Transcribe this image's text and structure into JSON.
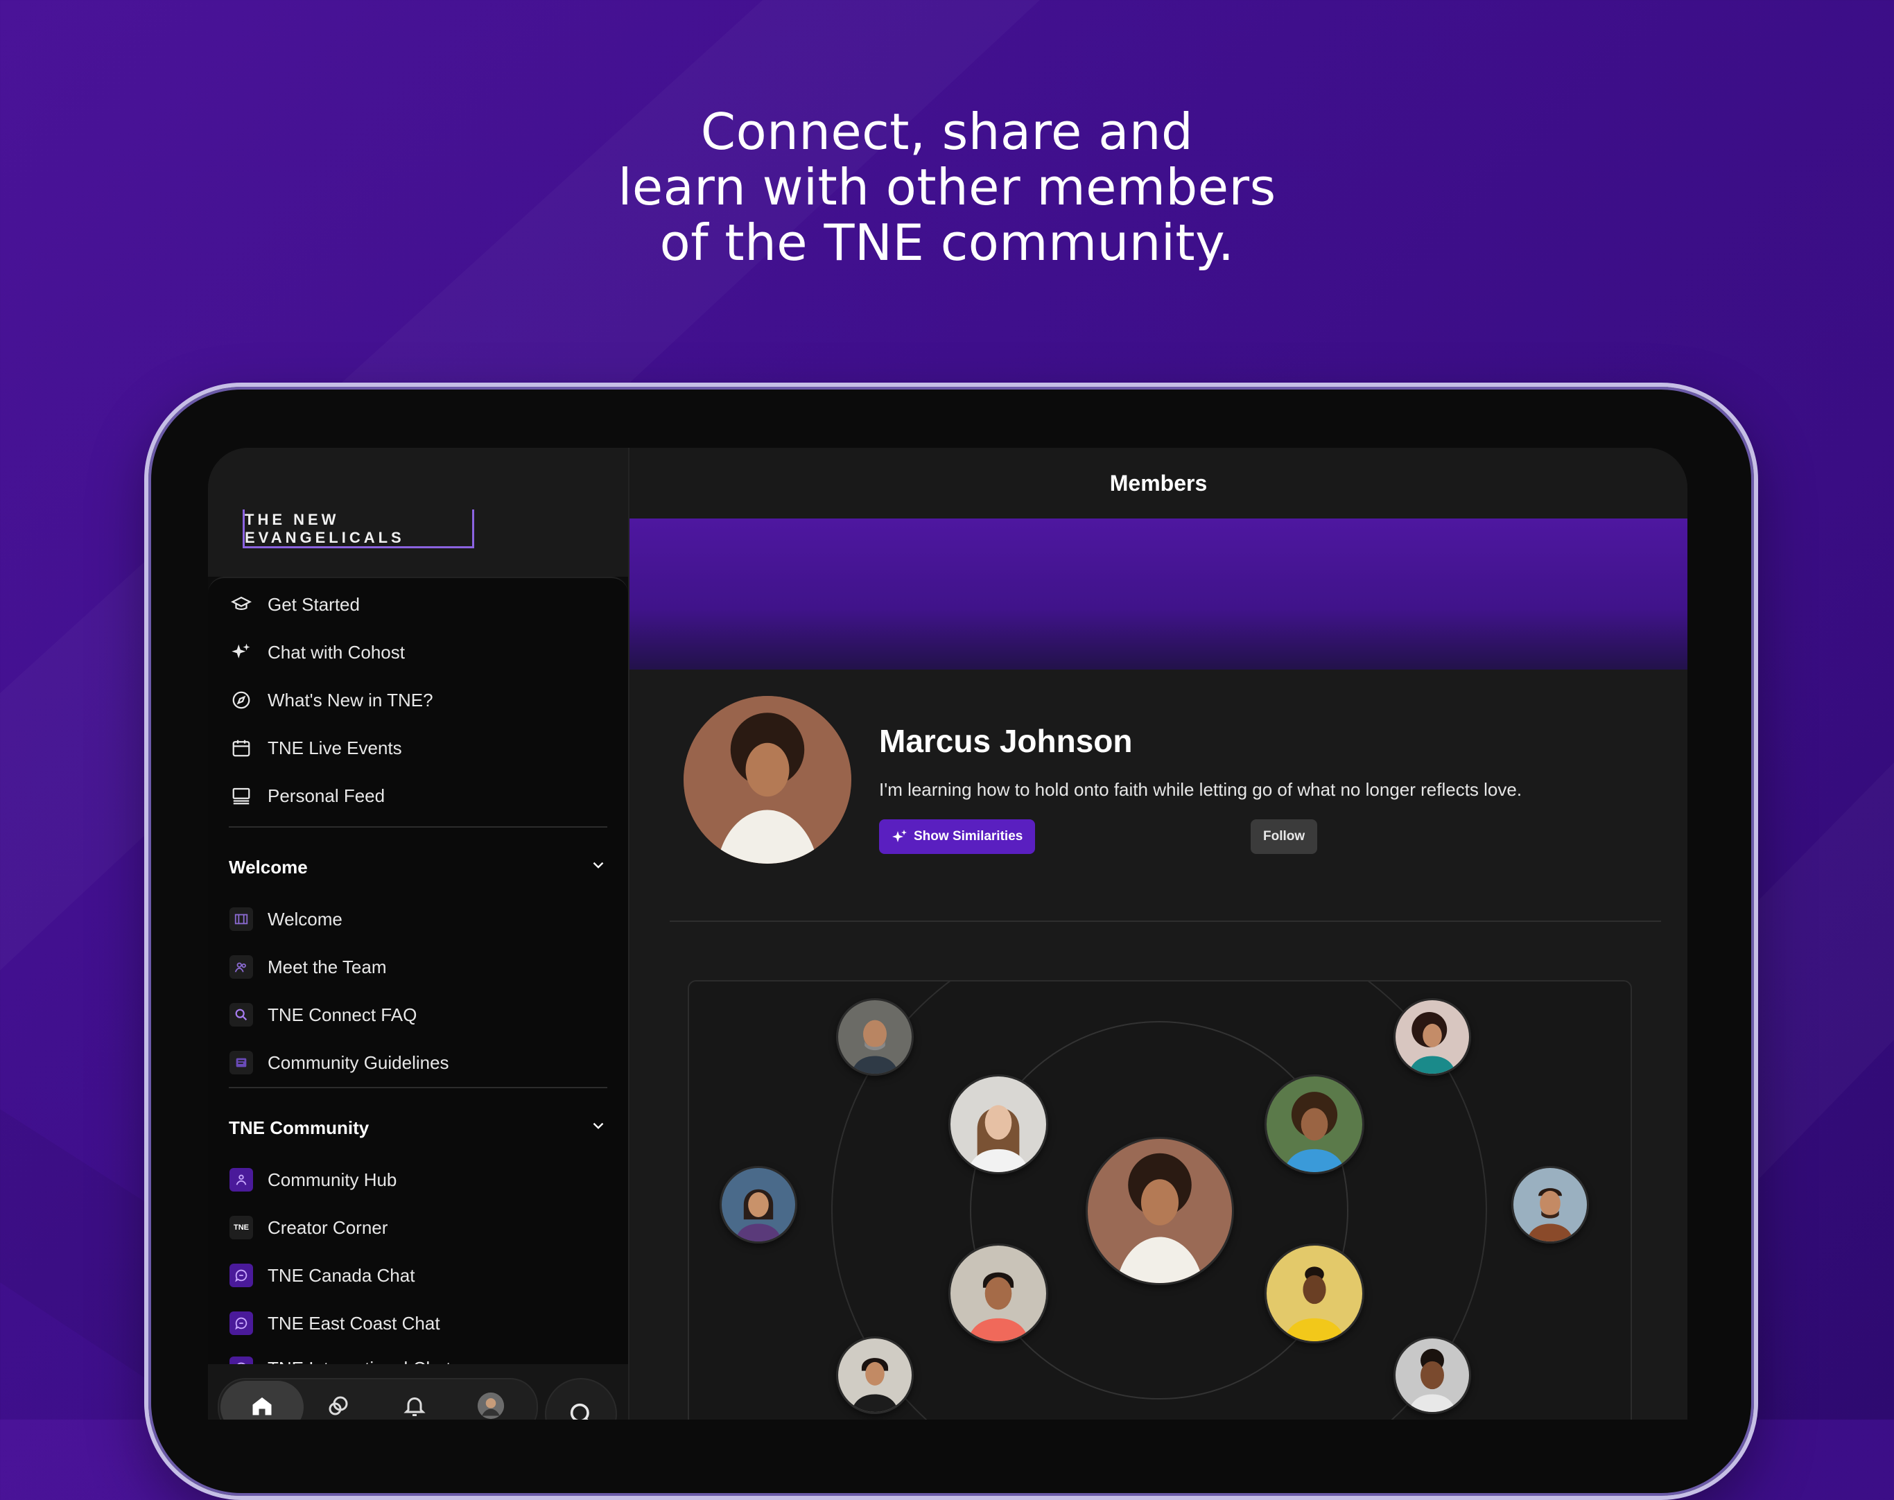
{
  "headline": {
    "line1": "Connect, share and",
    "line2": "learn with other members",
    "line3": "of the TNE community."
  },
  "sidebar": {
    "logo_text": "THE NEW EVANGELICALS",
    "primary_items": [
      {
        "label": "Get Started",
        "icon": "graduation-cap-icon"
      },
      {
        "label": "Chat with Cohost",
        "icon": "sparkle-icon"
      },
      {
        "label": "What's New in TNE?",
        "icon": "compass-icon"
      },
      {
        "label": "TNE Live Events",
        "icon": "calendar-icon"
      },
      {
        "label": "Personal Feed",
        "icon": "feed-icon"
      }
    ],
    "sections": [
      {
        "title": "Welcome",
        "items": [
          {
            "label": "Welcome"
          },
          {
            "label": "Meet the Team"
          },
          {
            "label": "TNE Connect FAQ"
          },
          {
            "label": "Community Guidelines"
          }
        ]
      },
      {
        "title": "TNE Community",
        "items": [
          {
            "label": "Community Hub"
          },
          {
            "label": "Creator Corner",
            "badge_text": "TNE"
          },
          {
            "label": "TNE Canada Chat"
          },
          {
            "label": "TNE East Coast Chat"
          },
          {
            "label": "TNE International Chat"
          }
        ]
      }
    ]
  },
  "bottom_nav": {
    "icons": [
      "home-icon",
      "spaces-icon",
      "bell-icon",
      "profile-avatar-icon",
      "search-icon"
    ]
  },
  "main": {
    "header_title": "Members",
    "profile": {
      "name": "Marcus Johnson",
      "bio": "I'm learning how to hold onto faith while letting go of what no longer reflects love.",
      "show_similarities_label": "Show Similarities",
      "follow_label": "Follow"
    }
  },
  "colors": {
    "background_purple": "#45118f",
    "accent": "#5a1fc0",
    "device_bezel": "#c6bfe6"
  }
}
